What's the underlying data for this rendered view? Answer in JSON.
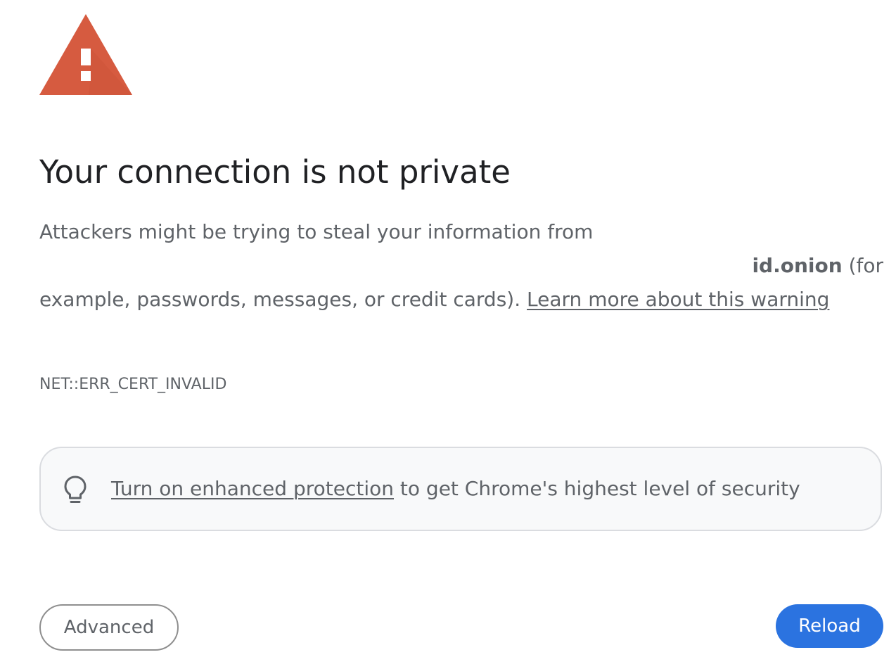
{
  "page": {
    "title": "Your connection is not private",
    "message": {
      "text_before": "Attackers might be trying to steal your information from",
      "domain": "id.onion",
      "text_for": "(for",
      "text_after": "example, passwords, messages, or credit cards).",
      "learn_more_link": "Learn more about this warning"
    },
    "error_code": "NET::ERR_CERT_INVALID",
    "enhanced_protection": {
      "link_text": "Turn on enhanced protection",
      "text": "to get Chrome's highest level of security",
      "icon": "lightbulb-icon"
    },
    "buttons": {
      "advanced": "Advanced",
      "reload": "Reload"
    },
    "icons": {
      "warning": "warning-triangle-icon"
    }
  },
  "colors": {
    "warning_red": "#d65b40",
    "title_text": "#202124",
    "body_text": "#5f6368",
    "card_background": "#f8f9fa",
    "card_border": "#dadce0",
    "reload_blue": "#2b73e0"
  }
}
